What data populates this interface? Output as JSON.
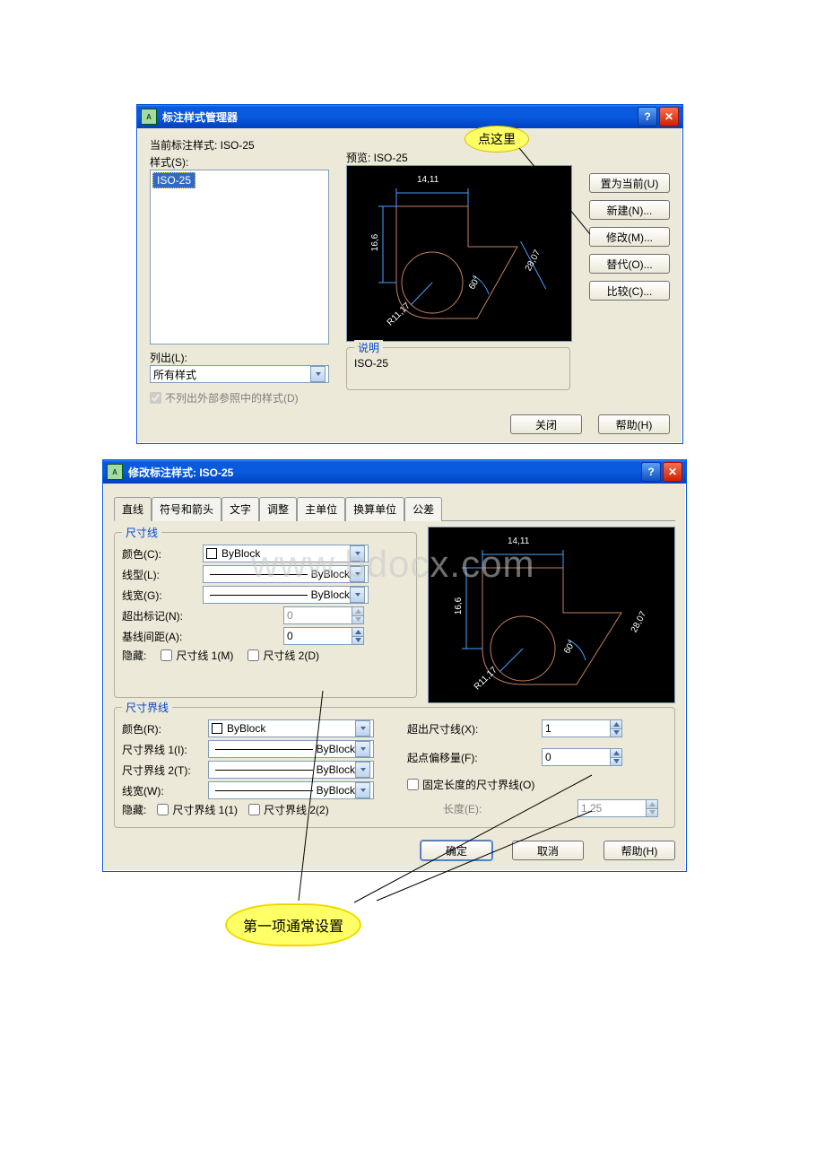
{
  "dialog1": {
    "title": "标注样式管理器",
    "current_label": "当前标注样式: ISO-25",
    "styles_label": "样式(S):",
    "selected_style": "ISO-25",
    "list_label": "列出(L):",
    "list_value": "所有样式",
    "exclude_xref": "不列出外部参照中的样式(D)",
    "preview_label": "预览: ISO-25",
    "desc_label": "说明",
    "desc_value": "ISO-25",
    "buttons": {
      "setcurrent": "置为当前(U)",
      "new": "新建(N)...",
      "modify": "修改(M)...",
      "override": "替代(O)...",
      "compare": "比较(C)..."
    },
    "close": "关闭",
    "help": "帮助(H)",
    "callout": "点这里"
  },
  "dialog2": {
    "title": "修改标注样式: ISO-25",
    "tabs": [
      "直线",
      "符号和箭头",
      "文字",
      "调整",
      "主单位",
      "换算单位",
      "公差"
    ],
    "dimlines": {
      "legend": "尺寸线",
      "color": "颜色(C):",
      "color_val": "ByBlock",
      "linetype": "线型(L):",
      "linetype_val": "ByBlock",
      "lineweight": "线宽(G):",
      "lineweight_val": "ByBlock",
      "extend": "超出标记(N):",
      "extend_val": "0",
      "baseline": "基线间距(A):",
      "baseline_val": "0",
      "hide": "隐藏:",
      "dimline1": "尺寸线 1(M)",
      "dimline2": "尺寸线 2(D)"
    },
    "extlines": {
      "legend": "尺寸界线",
      "color": "颜色(R):",
      "color_val": "ByBlock",
      "ext1": "尺寸界线 1(I):",
      "ext1_val": "ByBlock",
      "ext2": "尺寸界线 2(T):",
      "ext2_val": "ByBlock",
      "lw": "线宽(W):",
      "lw_val": "ByBlock",
      "hide": "隐藏:",
      "extline1": "尺寸界线 1(1)",
      "extline2": "尺寸界线 2(2)",
      "extend_beyond": "超出尺寸线(X):",
      "extend_beyond_val": "1",
      "offset_origin": "起点偏移量(F):",
      "offset_origin_val": "0",
      "fixed_len": "固定长度的尺寸界线(O)",
      "length": "长度(E):",
      "length_val": "1.25"
    },
    "ok": "确定",
    "cancel": "取消",
    "help": "帮助(H)",
    "callout": "第一项通常设置"
  },
  "preview_dims": {
    "top": "14,11",
    "left": "16,6",
    "diag": "28,07",
    "angle": "60°",
    "radius": "R11,17"
  },
  "watermark": "www.bdocx.com"
}
